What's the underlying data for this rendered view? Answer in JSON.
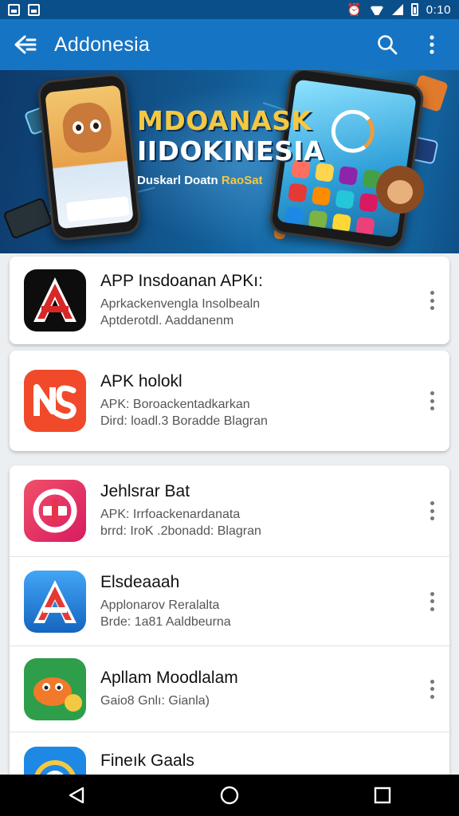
{
  "status_bar": {
    "time": "0:10"
  },
  "app_bar": {
    "title": "Addonesia"
  },
  "banner": {
    "headline_1": "MDOANASK",
    "headline_2": "IIDOKINESIA",
    "tagline_a": "Duskarl Doatn",
    "tagline_b": "RaoSat"
  },
  "apps": [
    {
      "name": "APP Insdoanan APKı:",
      "line1": "Aprkackenvengla Insolbealn",
      "line2": "Aptderotdl. Aaddanenm",
      "icon": "red-a-logo-icon",
      "color": "#d62828"
    },
    {
      "name": "APK holokl",
      "line1": "APK: Boroackentadkarkan",
      "line2": "Dird: loadl.3 Boradde Blagran",
      "icon": "ns-logo-icon",
      "color": "#f04a2a"
    },
    {
      "name": "Jehlsrar Bat",
      "line1": "APK: Irrfoackenardanata",
      "line2": "brrd: IroK .2bonadd: Blagran",
      "icon": "chat-logo-icon",
      "color": "#e8344a"
    },
    {
      "name": "Elsdeaaah",
      "line1": "Applonarov Reralalta",
      "line2": "Brde: 1a81 Aaldbeurna",
      "icon": "blue-a-logo-icon",
      "color": "#1e88e5"
    },
    {
      "name": "Apllam Moodlalam",
      "line1": "Gaio8 Gnlı: Gianla)",
      "line2": "",
      "icon": "monster-logo-icon",
      "color": "#2e9e4a"
    },
    {
      "name": "Fineık Gaals",
      "line1": "",
      "line2": "",
      "icon": "blue-circle-logo-icon",
      "color": "#1565c0"
    }
  ]
}
